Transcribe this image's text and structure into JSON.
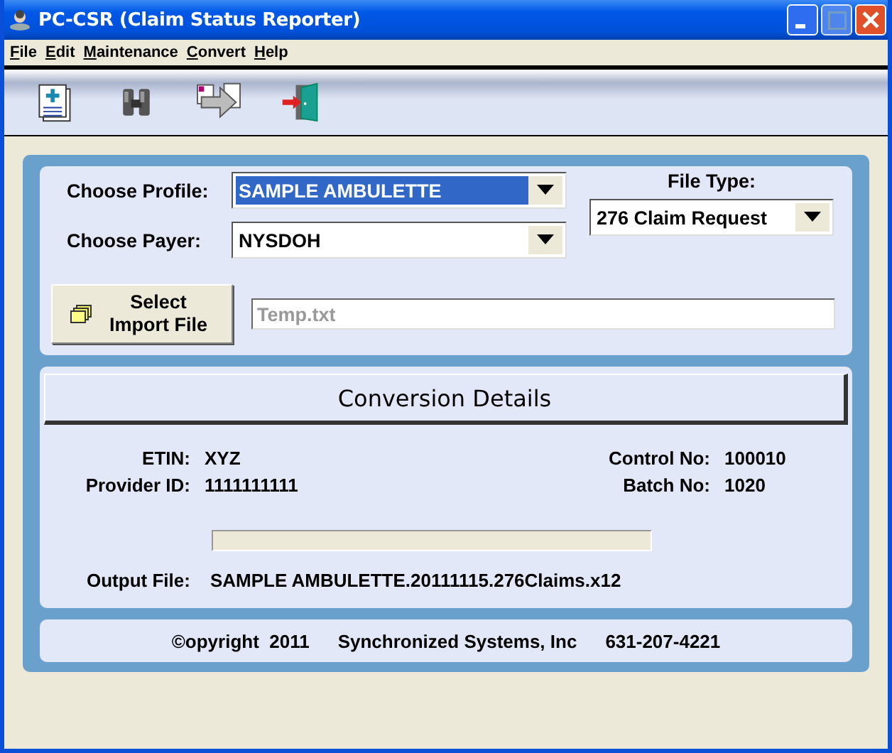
{
  "window": {
    "title": "PC-CSR (Claim Status Reporter)"
  },
  "menu": [
    "File",
    "Edit",
    "Maintenance",
    "Convert",
    "Help"
  ],
  "toolbar": [
    {
      "kind": "new"
    },
    {
      "kind": "find"
    },
    {
      "kind": "convert"
    },
    {
      "kind": "exit"
    }
  ],
  "form": {
    "profile": {
      "label": "Choose Profile:",
      "value": "SAMPLE AMBULETTE",
      "focused": true
    },
    "payer": {
      "label": "Choose Payer:",
      "value": "NYSDOH",
      "focused": false
    },
    "file_type": {
      "label": "File Type:",
      "value": "276 Claim Request"
    },
    "import_button": {
      "line1": "Select",
      "line2": "Import File"
    },
    "import_path": {
      "placeholder": "Temp.txt"
    }
  },
  "details": {
    "header": "Conversion Details",
    "left": [
      {
        "label": "ETIN:",
        "value": "XYZ"
      },
      {
        "label": "Provider ID:",
        "value": "1111111111"
      }
    ],
    "right": [
      {
        "label": "Control No:",
        "value": "100010"
      },
      {
        "label": "Batch No:",
        "value": "1020"
      }
    ],
    "progress": {
      "level": 0
    },
    "output": {
      "label": "Output File:",
      "value": "SAMPLE AMBULETTE.20111115.276Claims.x12"
    }
  },
  "footer": {
    "copyright": "©opyright  2011",
    "company": "Synchronized Systems, Inc",
    "phone": "631-207-4221"
  }
}
